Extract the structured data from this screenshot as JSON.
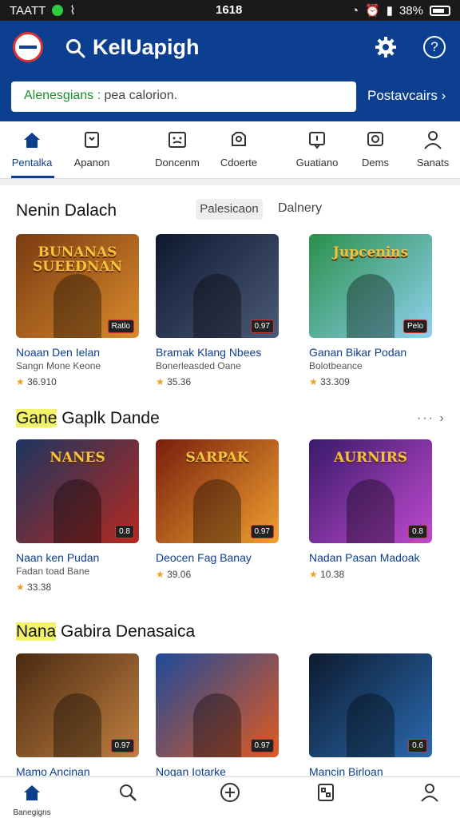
{
  "status_bar": {
    "carrier": "TAATT",
    "time": "1618",
    "battery": "38%"
  },
  "app_bar": {
    "title": "KelUapigh",
    "search": {
      "value_green": "Alenesgians :",
      "value_rest": " pea calorion."
    },
    "presets_label": "Postavcairs ›"
  },
  "tabs": [
    {
      "label": "Pentalka",
      "icon": "home-icon"
    },
    {
      "label": "Apanon",
      "icon": "tag-icon"
    },
    {
      "label": "Doncenm",
      "icon": "gamepad-icon"
    },
    {
      "label": "Cdoerte",
      "icon": "puzzle-icon"
    },
    {
      "label": "Guatiano",
      "icon": "message-icon"
    },
    {
      "label": "Dems",
      "icon": "monitor-icon"
    },
    {
      "label": "Sanats",
      "icon": "person-icon"
    }
  ],
  "sections": [
    {
      "title": "Nenin Dalach",
      "title_highlight": "",
      "filters": [
        "Palesicaon",
        "Dalnery"
      ],
      "cards": [
        {
          "name": "Noaan Den Ielan",
          "sub": "Sangn Mone Keone",
          "rating": "36.910",
          "art_title": "BUNANAS SUEEDNAN",
          "badge": "Ratlo",
          "colors": [
            "#7a3b12",
            "#d98a2b"
          ]
        },
        {
          "name": "Bramak Klang Nbees",
          "sub": "Bonerleasded Oane",
          "rating": "35.36",
          "art_title": "",
          "badge": "0.97",
          "colors": [
            "#101830",
            "#4a5a78"
          ]
        },
        {
          "name": "Ganan Bikar Podan",
          "sub": "Bolotbeance",
          "rating": "33.309",
          "art_title": "Jupcenins",
          "badge": "Pelo",
          "colors": [
            "#2a8f4a",
            "#8fd1f0"
          ]
        }
      ]
    },
    {
      "title": " Gaplk Dande",
      "title_highlight": "Gane",
      "more": "··· ›",
      "cards": [
        {
          "name": "Naan ken Pudan",
          "sub": "Fadan toad Bane",
          "rating": "33.38",
          "art_title": "NANES",
          "badge": "0.8",
          "colors": [
            "#1d3560",
            "#b32a20"
          ]
        },
        {
          "name": "Deocen Fag Banay",
          "sub": "",
          "rating": "39.06",
          "art_title": "SARPAK",
          "badge": "0.97",
          "colors": [
            "#7a1e0e",
            "#f0a030"
          ]
        },
        {
          "name": "Nadan Pasan Madoak",
          "sub": "",
          "rating": "10.38",
          "art_title": "AURNIRS",
          "badge": "0.8",
          "colors": [
            "#3a1a6a",
            "#c04ad0"
          ]
        }
      ]
    },
    {
      "title": " Gabira Denasaica",
      "title_highlight": "Nana",
      "cards": [
        {
          "name": "Mamo Ancinan",
          "sub": "",
          "rating": "",
          "art_title": "",
          "badge": "0.97",
          "colors": [
            "#4a2a12",
            "#c08040"
          ]
        },
        {
          "name": "Nogan Iotarke",
          "sub": "",
          "rating": "",
          "art_title": "",
          "badge": "0.97",
          "colors": [
            "#1e4a9a",
            "#e05a20"
          ]
        },
        {
          "name": "Mancin Birloan",
          "sub": "",
          "rating": "",
          "art_title": "",
          "badge": "0.6",
          "colors": [
            "#0d1a2e",
            "#2a6ab0"
          ]
        }
      ]
    }
  ],
  "bottom_nav": [
    {
      "label": "Banegigns",
      "icon": "home-icon"
    },
    {
      "label": "",
      "icon": "search-icon"
    },
    {
      "label": "",
      "icon": "add-circle-icon"
    },
    {
      "label": "",
      "icon": "library-icon"
    },
    {
      "label": "",
      "icon": "profile-icon"
    }
  ],
  "colors": {
    "brand": "#0c3f8f",
    "accent_highlight": "#f3f36a",
    "star": "#f0a020"
  }
}
